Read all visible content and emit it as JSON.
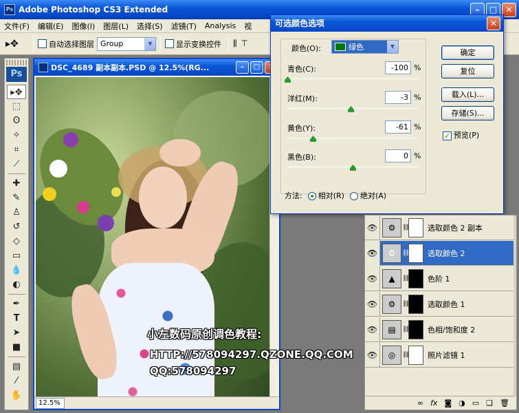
{
  "app": {
    "title": "Adobe Photoshop CS3 Extended"
  },
  "menu": [
    "文件(F)",
    "编辑(E)",
    "图像(I)",
    "图层(L)",
    "选择(S)",
    "滤镜(T)",
    "Analysis",
    "视"
  ],
  "options": {
    "auto_select_label": "自动选择图层",
    "group_value": "Group",
    "show_transform_label": "显示变换控件"
  },
  "toolbox": {
    "logo": "Ps"
  },
  "document": {
    "title": "DSC_4689 副本副本.PSD @ 12.5%(RG...",
    "zoom": "12.5%"
  },
  "dialog": {
    "title": "可选颜色选项",
    "color_label": "颜色(O):",
    "color_value": "绿色",
    "sliders": [
      {
        "label": "青色(C):",
        "value": "-100",
        "fraction": 0.0
      },
      {
        "label": "洋红(M):",
        "value": "-3",
        "fraction": 0.485
      },
      {
        "label": "黄色(Y):",
        "value": "-61",
        "fraction": 0.195
      },
      {
        "label": "黑色(B):",
        "value": "0",
        "fraction": 0.5
      }
    ],
    "percent": "%",
    "buttons": {
      "ok": "确定",
      "reset": "复位",
      "load": "载入(L)...",
      "save": "存储(S)..."
    },
    "preview_label": "预览(P)",
    "method_label": "方法:",
    "method_relative": "相对(R)",
    "method_absolute": "绝对(A)",
    "accent_color": "#007a00"
  },
  "layers": [
    {
      "name": "选取颜色 2 副本",
      "thumb": "adjust",
      "mask": "white",
      "selected": false
    },
    {
      "name": "选取颜色 2",
      "thumb": "adjust",
      "mask": "white",
      "selected": true
    },
    {
      "name": "色阶 1",
      "thumb": "levels",
      "mask": "black",
      "selected": false
    },
    {
      "name": "选取颜色 1",
      "thumb": "adjust",
      "mask": "black",
      "selected": false
    },
    {
      "name": "色相/饱和度 2",
      "thumb": "huesat",
      "mask": "black",
      "selected": false
    },
    {
      "name": "照片滤镜 1",
      "thumb": "photo",
      "mask": "white",
      "selected": false
    }
  ],
  "watermark": {
    "line1": "小左数码原创调色教程:",
    "line2": "HTTP://578094297.QZONE.QQ.COM",
    "line3": "QQ:578094297"
  }
}
